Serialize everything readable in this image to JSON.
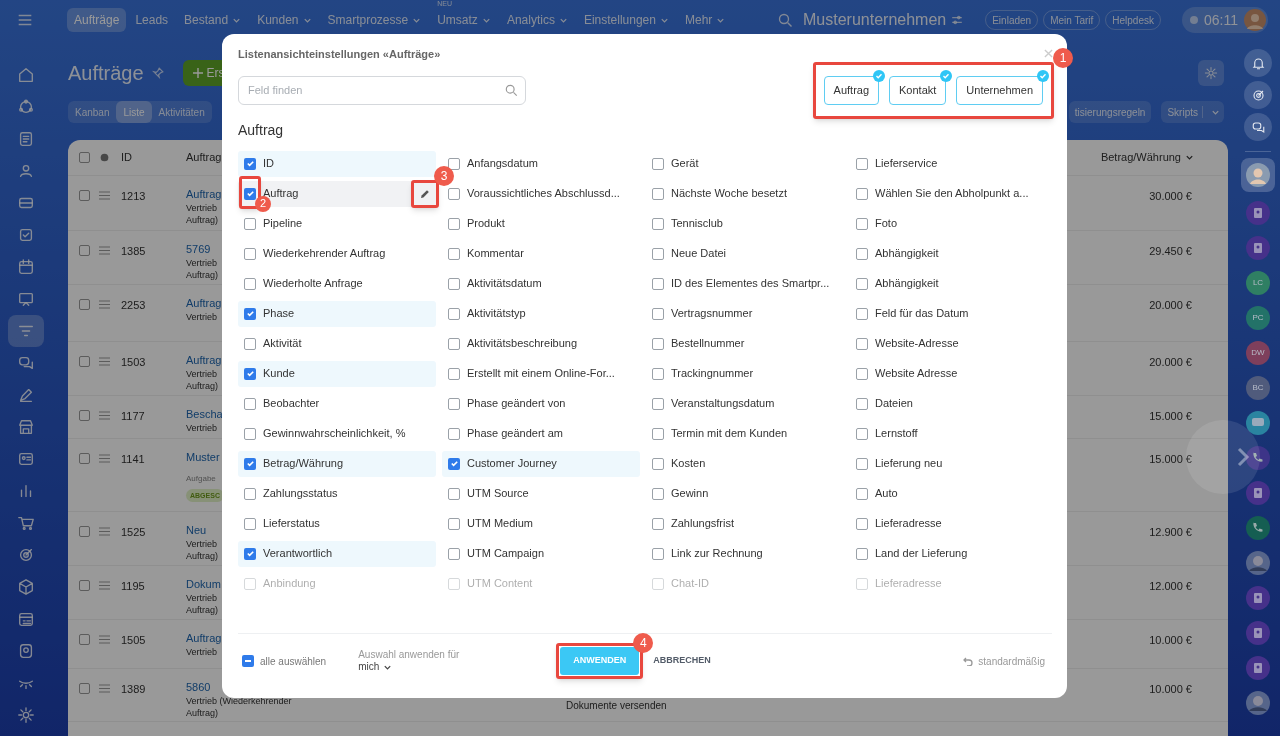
{
  "topbar": {
    "nav": [
      {
        "label": "Aufträge",
        "selected": true,
        "dropdown": false
      },
      {
        "label": "Leads",
        "selected": false,
        "dropdown": false
      },
      {
        "label": "Bestand",
        "selected": false,
        "dropdown": true
      },
      {
        "label": "Kunden",
        "selected": false,
        "dropdown": true
      },
      {
        "label": "Smartprozesse",
        "selected": false,
        "dropdown": true
      },
      {
        "label": "Umsatz",
        "selected": false,
        "dropdown": true,
        "badge": "NEU"
      },
      {
        "label": "Analytics",
        "selected": false,
        "dropdown": true
      },
      {
        "label": "Einstellungen",
        "selected": false,
        "dropdown": true
      },
      {
        "label": "Mehr",
        "selected": false,
        "dropdown": true
      }
    ],
    "company": "Musterunternehmen",
    "buttons": [
      "Einladen",
      "Mein Tarif",
      "Helpdesk"
    ],
    "time": "06:11"
  },
  "page": {
    "title": "Aufträge",
    "create_button": "Ers",
    "views": [
      {
        "label": "Kanban",
        "selected": false
      },
      {
        "label": "Liste",
        "selected": true
      },
      {
        "label": "Aktivitäten",
        "selected": false
      }
    ],
    "right_buttons": [
      "tisierungsregeln",
      "Skripts"
    ]
  },
  "table": {
    "columns": [
      "ID",
      "Auftrag",
      "Betrag/Währung"
    ],
    "rows": [
      {
        "id": "1213",
        "checked": false,
        "title": "Auftrag",
        "sub": [
          "Vertrieb",
          "Auftrag)"
        ],
        "amount": "30.000 €"
      },
      {
        "id": "1385",
        "checked": false,
        "title": "5769",
        "sub": [
          "Vertrieb",
          "Auftrag)"
        ],
        "amount": "29.450 €"
      },
      {
        "id": "2253",
        "checked": false,
        "title": "Auftrag",
        "sub": [
          "Vertrieb"
        ],
        "amount": "20.000 €"
      },
      {
        "id": "1503",
        "checked": false,
        "title": "Auftrag",
        "sub": [
          "Vertrieb",
          "Auftrag)"
        ],
        "amount": "20.000 €"
      },
      {
        "id": "1177",
        "checked": false,
        "title": "Bescha",
        "sub": [
          "Vertrieb"
        ],
        "amount": "15.000 €"
      },
      {
        "id": "1141",
        "checked": false,
        "title": "Muster",
        "note": "Aufgabe",
        "tag": "ABGESC",
        "amount": "15.000 €"
      },
      {
        "id": "1525",
        "checked": false,
        "title": "Neu",
        "sub": [
          "Vertrieb",
          "Auftrag)"
        ],
        "amount": "12.900 €"
      },
      {
        "id": "1195",
        "checked": false,
        "title": "Dokum",
        "sub": [
          "Vertrieb",
          "Auftrag)"
        ],
        "amount": "12.000 €"
      },
      {
        "id": "1505",
        "checked": false,
        "title": "Auftrag",
        "sub": [
          "Vertrieb"
        ],
        "amount": "10.000 €"
      },
      {
        "id": "1389",
        "checked": false,
        "title": "5860",
        "sub": [
          "Vertrieb (Wiederkehrender",
          "Auftrag)"
        ],
        "extra": "Dokumente versenden",
        "amount": "10.000 €"
      }
    ],
    "all_checked": false
  },
  "right_rail": [
    {
      "kind": "contact"
    },
    {
      "kind": "contact"
    },
    {
      "kind": "initials",
      "text": "LC",
      "color": "#2f7f63"
    },
    {
      "kind": "initials",
      "text": "PC",
      "color": "#237268"
    },
    {
      "kind": "initials",
      "text": "DW",
      "color": "#7e3f5c"
    },
    {
      "kind": "initials",
      "text": "BC",
      "color": "#505b7c"
    },
    {
      "kind": "chat"
    },
    {
      "kind": "phone"
    },
    {
      "kind": "contact"
    },
    {
      "kind": "phone_green"
    },
    {
      "kind": "picture"
    },
    {
      "kind": "contact"
    },
    {
      "kind": "contact"
    },
    {
      "kind": "contact"
    },
    {
      "kind": "picture"
    }
  ],
  "dialog": {
    "title": "Listenansichteinstellungen «Aufträge»",
    "search": {
      "placeholder": "Feld finden"
    },
    "entities": {
      "step": "1",
      "items": [
        {
          "label": "Auftrag",
          "selected": true
        },
        {
          "label": "Kontakt",
          "selected": true
        },
        {
          "label": "Unternehmen",
          "selected": true
        }
      ]
    },
    "section": "Auftrag",
    "fields": [
      {
        "label": "ID",
        "checked": true
      },
      {
        "label": "Anfangsdatum",
        "checked": false
      },
      {
        "label": "Gerät",
        "checked": false
      },
      {
        "label": "Lieferservice",
        "checked": false
      },
      {
        "label": "Auftrag",
        "checked": true,
        "hovered": true,
        "checkbox_step": "2",
        "edit_step": "3"
      },
      {
        "label": "Voraussichtliches Abschlussd...",
        "checked": false
      },
      {
        "label": "Nächste Woche besetzt",
        "checked": false
      },
      {
        "label": "Wählen Sie den Abholpunkt a...",
        "checked": false
      },
      {
        "label": "Pipeline",
        "checked": false
      },
      {
        "label": "Produkt",
        "checked": false
      },
      {
        "label": "Tennisclub",
        "checked": false
      },
      {
        "label": "Foto",
        "checked": false
      },
      {
        "label": "Wiederkehrender Auftrag",
        "checked": false
      },
      {
        "label": "Kommentar",
        "checked": false
      },
      {
        "label": "Neue Datei",
        "checked": false
      },
      {
        "label": "Abhängigkeit",
        "checked": false
      },
      {
        "label": "Wiederholte Anfrage",
        "checked": false
      },
      {
        "label": "Aktivitätsdatum",
        "checked": false
      },
      {
        "label": "ID des Elementes des Smartpr...",
        "checked": false
      },
      {
        "label": "Abhängigkeit",
        "checked": false
      },
      {
        "label": "Phase",
        "checked": true
      },
      {
        "label": "Aktivitätstyp",
        "checked": false
      },
      {
        "label": "Vertragsnummer",
        "checked": false
      },
      {
        "label": "Feld für das Datum",
        "checked": false
      },
      {
        "label": "Aktivität",
        "checked": false
      },
      {
        "label": "Aktivitätsbeschreibung",
        "checked": false
      },
      {
        "label": "Bestellnummer",
        "checked": false
      },
      {
        "label": "Website-Adresse",
        "checked": false
      },
      {
        "label": "Kunde",
        "checked": true
      },
      {
        "label": "Erstellt mit einem Online-For...",
        "checked": false
      },
      {
        "label": "Trackingnummer",
        "checked": false
      },
      {
        "label": "Website Adresse",
        "checked": false
      },
      {
        "label": "Beobachter",
        "checked": false
      },
      {
        "label": "Phase geändert von",
        "checked": false
      },
      {
        "label": "Veranstaltungsdatum",
        "checked": false
      },
      {
        "label": "Dateien",
        "checked": false
      },
      {
        "label": "Gewinnwahrscheinlichkeit, %",
        "checked": false
      },
      {
        "label": "Phase geändert am",
        "checked": false
      },
      {
        "label": "Termin mit dem Kunden",
        "checked": false
      },
      {
        "label": "Lernstoff",
        "checked": false
      },
      {
        "label": "Betrag/Währung",
        "checked": true
      },
      {
        "label": "Customer Journey",
        "checked": true
      },
      {
        "label": "Kosten",
        "checked": false
      },
      {
        "label": "Lieferung neu",
        "checked": false
      },
      {
        "label": "Zahlungsstatus",
        "checked": false
      },
      {
        "label": "UTM Source",
        "checked": false
      },
      {
        "label": "Gewinn",
        "checked": false
      },
      {
        "label": "Auto",
        "checked": false
      },
      {
        "label": "Lieferstatus",
        "checked": false
      },
      {
        "label": "UTM Medium",
        "checked": false
      },
      {
        "label": "Zahlungsfrist",
        "checked": false
      },
      {
        "label": "Lieferadresse",
        "checked": false
      },
      {
        "label": "Verantwortlich",
        "checked": true
      },
      {
        "label": "UTM Campaign",
        "checked": false
      },
      {
        "label": "Link zur Rechnung",
        "checked": false
      },
      {
        "label": "Land der Lieferung",
        "checked": false
      },
      {
        "label": "Anbindung",
        "checked": false
      },
      {
        "label": "UTM Content",
        "checked": false
      },
      {
        "label": "Chat-ID",
        "checked": false
      },
      {
        "label": "Lieferadresse",
        "checked": false
      }
    ],
    "select_all": {
      "label": "alle auswählen",
      "partial": true
    },
    "apply_for": {
      "label": "Auswahl anwenden für",
      "value": "mich"
    },
    "apply": {
      "label": "ANWENDEN",
      "step": "4"
    },
    "cancel": "ABBRECHEN",
    "reset": "standardmäßig"
  }
}
